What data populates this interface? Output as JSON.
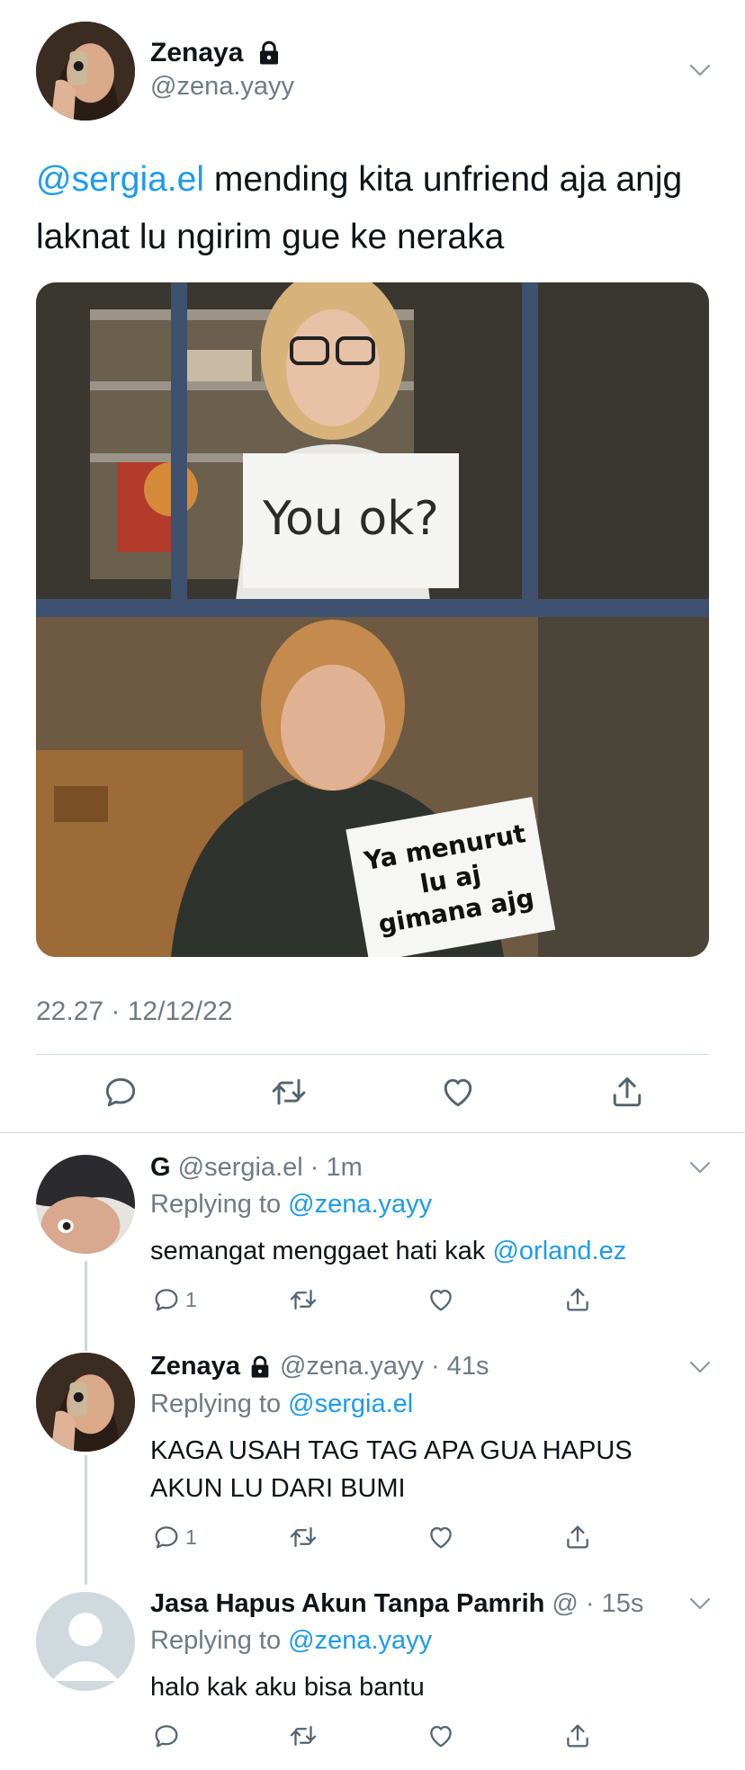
{
  "tweet": {
    "author_name": "Zenaya",
    "author_handle": "@zena.yayy",
    "text_mention": "@sergia.el",
    "text_body": " mending kita unfriend aja anjg laknat lu ngirim gue ke neraka",
    "meme_top_sign": "You ok?",
    "meme_bottom_sign": "Ya menurut lu aj gimana ajg",
    "timestamp": "22.27 · 12/12/22",
    "icons": [
      "reply-icon",
      "retweet-icon",
      "like-icon",
      "share-icon",
      "chevron-down-icon",
      "lock-icon"
    ]
  },
  "replies": [
    {
      "name": "G",
      "handle": "@sergia.el",
      "time": " · 1m",
      "replying_label": "Replying to ",
      "replying_to": "@zena.yayy",
      "text": "semangat menggaet hati kak ",
      "mention": "@orland.ez",
      "reply_count": "1"
    },
    {
      "name": "Zenaya",
      "handle": "@zena.yayy",
      "time": " · 41s",
      "replying_label": "Replying to ",
      "replying_to": "@sergia.el",
      "text": "KAGA USAH TAG TAG APA GUA HAPUS AKUN LU DARI BUMI",
      "reply_count": "1"
    },
    {
      "name": "Jasa Hapus Akun Tanpa Pamrih",
      "handle": "@",
      "time": " · 15s",
      "replying_label": "Replying to ",
      "replying_to": "@zena.yayy",
      "text": "halo kak aku bisa bantu",
      "reply_count": ""
    }
  ],
  "colors": {
    "link": "#1d9bf0",
    "muted": "#6e7b86",
    "divider": "#cfd9de"
  }
}
